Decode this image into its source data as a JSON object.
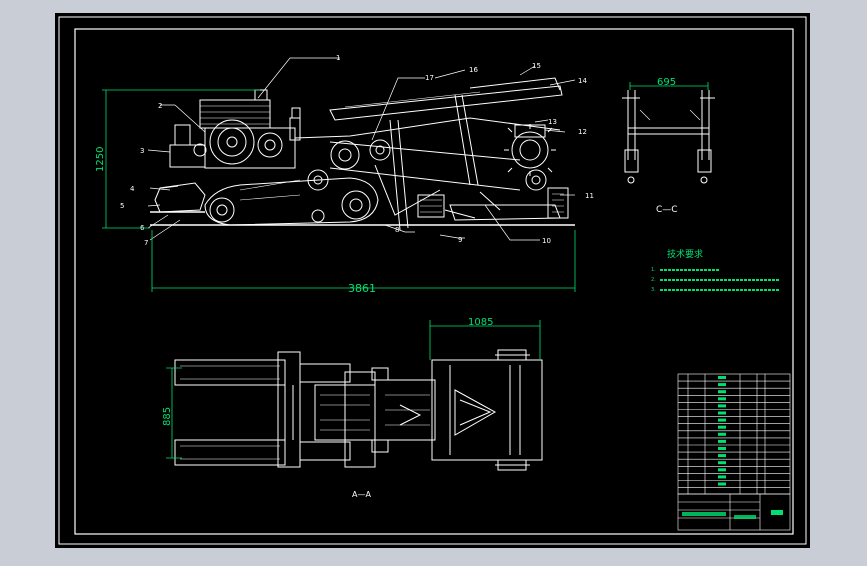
{
  "main_view": {
    "dimensions": {
      "height": "1250",
      "length": "3861"
    },
    "part_labels": [
      "1",
      "2",
      "3",
      "4",
      "5",
      "6",
      "7",
      "8",
      "9",
      "10",
      "11",
      "12",
      "13",
      "14",
      "15",
      "16",
      "17"
    ]
  },
  "section_cc": {
    "width_dim": "695",
    "label": "C—C"
  },
  "section_aa": {
    "length_dim": "1085",
    "width_dim": "885",
    "label": "A—A"
  },
  "tech_requirements": {
    "title": "技术要求",
    "items": [
      "1.",
      "2.",
      "3."
    ]
  },
  "colors": {
    "background": "#000000",
    "frame": "#ffffff",
    "dimension": "#00e070",
    "page": "#c9ced6"
  }
}
